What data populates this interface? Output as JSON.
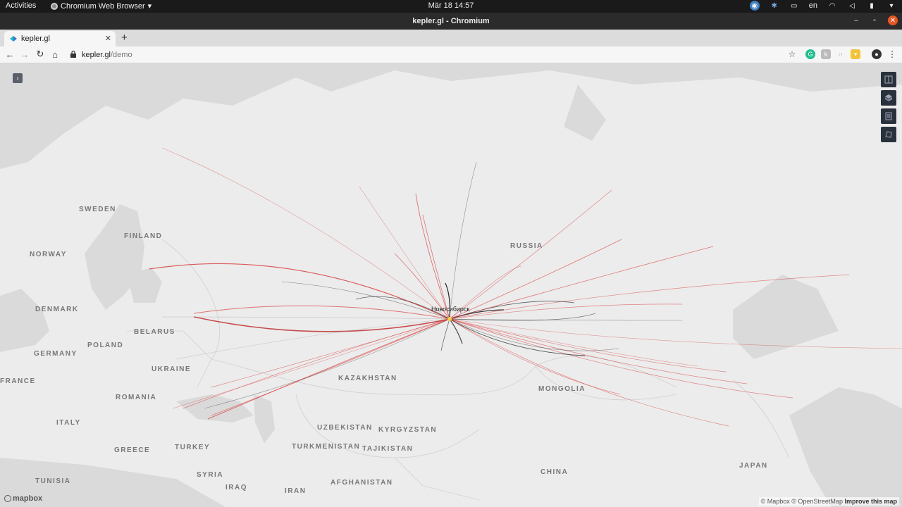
{
  "system": {
    "activities": "Activities",
    "app_name": "Chromium Web Browser",
    "clock": "Mär 18  14:57",
    "lang": "en"
  },
  "window": {
    "title": "kepler.gl - Chromium"
  },
  "tab": {
    "title": "kepler.gl"
  },
  "toolbar": {
    "url_host": "kepler.gl",
    "url_path": "/demo"
  },
  "map": {
    "countries": [
      {
        "name": "SWEDEN"
      },
      {
        "name": "FINLAND"
      },
      {
        "name": "NORWAY"
      },
      {
        "name": "RUSSIA"
      },
      {
        "name": "DENMARK"
      },
      {
        "name": "BELARUS"
      },
      {
        "name": "GERMANY"
      },
      {
        "name": "POLAND"
      },
      {
        "name": "UKRAINE"
      },
      {
        "name": "FRANCE"
      },
      {
        "name": "KAZAKHSTAN"
      },
      {
        "name": "MONGOLIA"
      },
      {
        "name": "ROMANIA"
      },
      {
        "name": "ITALY"
      },
      {
        "name": "UZBEKISTAN"
      },
      {
        "name": "KYRGYZSTAN"
      },
      {
        "name": "GREECE"
      },
      {
        "name": "TURKEY"
      },
      {
        "name": "TURKMENISTAN"
      },
      {
        "name": "TAJIKISTAN"
      },
      {
        "name": "SYRIA"
      },
      {
        "name": "CHINA"
      },
      {
        "name": "JAPAN"
      },
      {
        "name": "TUNISIA"
      },
      {
        "name": "IRAQ"
      },
      {
        "name": "IRAN"
      },
      {
        "name": "AFGHANISTAN"
      }
    ],
    "hub_city": "Новосибирск",
    "arc_colors": {
      "red": "#d94040",
      "dark": "#222222",
      "hub": "#f5d13b"
    },
    "logo": "mapbox",
    "attribution": "© Mapbox © OpenStreetMap",
    "improve": "Improve this map"
  }
}
